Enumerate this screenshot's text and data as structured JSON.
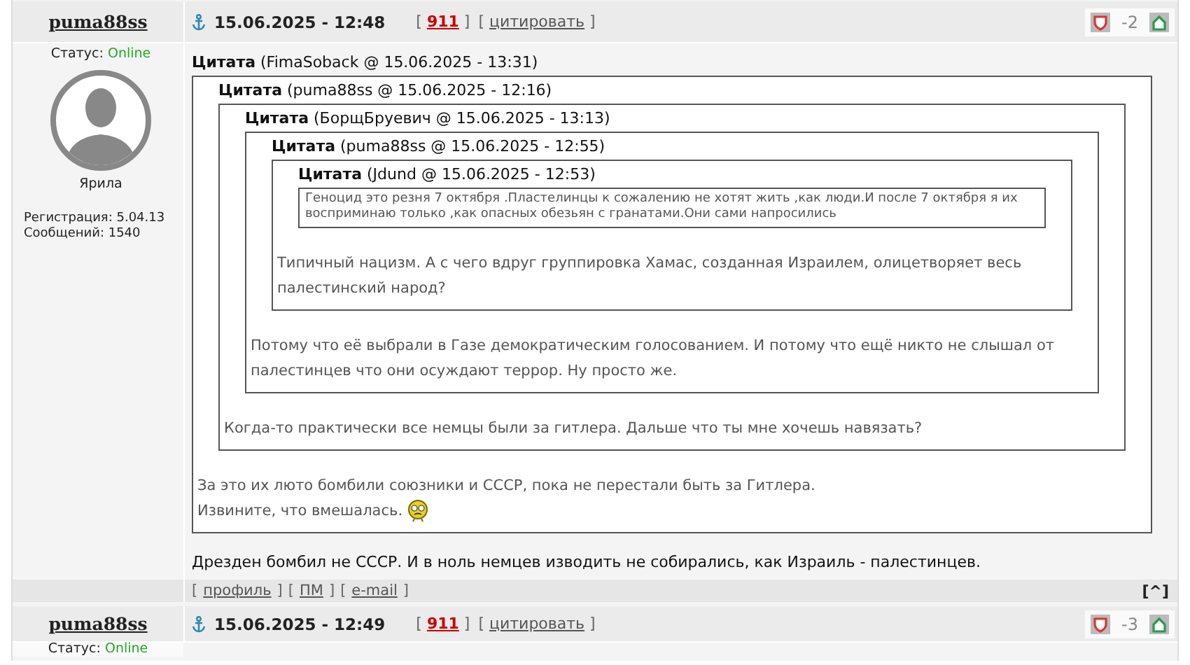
{
  "posts": [
    {
      "author": "puma88ss",
      "date": "15.06.2025 - 12:48",
      "links": [
        {
          "open": "[",
          "text": "911",
          "close": "]",
          "kind": "number"
        },
        {
          "open": "[",
          "text": "цитировать",
          "close": "]",
          "kind": "link"
        }
      ],
      "rating": "-2",
      "status_label": "Статус:",
      "status": "Online",
      "rank": "Ярила",
      "stats": [
        "Регистрация: 5.04.13",
        "Сообщений: 1540"
      ],
      "quote": {
        "header": "**Цитата** (FimaSoback @ 15.06.2025 - 13:31)",
        "quote": {
          "header": "**Цитата** (puma88ss @ 15.06.2025 - 12:16)",
          "quote": {
            "header": "**Цитата** (БорщБруевич @ 15.06.2025 - 13:13)",
            "quote": {
              "header": "**Цитата** (puma88ss @ 15.06.2025 - 12:55)",
              "quote": {
                "header": "**Цитата** (Jdund @ 15.06.2025 - 12:53)",
                "lines": [
                  "Геноцид это резня 7 октября .Пластелинцы к сожалению не хотят жить ,как люди.И после 7 октября я их восприминаю только ,как опасных обезьян с гранатами.Они сами напросились"
                ]
              },
              "lines": [
                "Типичный нацизм. А с чего вдруг группировка Хамас, созданная Израилем, олицетворяет весь палестинский народ?"
              ]
            },
            "lines": [
              "Потому что её выбрали в Газе демократическим голосованием. И потому что ещё никто не слышал от палестинцев что они осуждают террор. Ну просто же."
            ]
          },
          "lines": [
            "Когда-то практически все немцы были за гитлера. Дальше что ты мне хочешь навязать?"
          ]
        },
        "lines": [
          "За это их люто бомбили союзники и СССР, пока не перестали быть за Гитлера.",
          "Извините, что вмешалась."
        ],
        "smiley": true
      },
      "text": "Дрезден бомбил не СССР. И в ноль немцев изводить не собирались, как Израиль - палестинцев.",
      "footer_links": [
        {
          "open": "[",
          "text": "профиль",
          "close": "]"
        },
        {
          "open": "[",
          "text": "ПМ",
          "close": "]"
        },
        {
          "open": "[",
          "text": "e-mail",
          "close": "]"
        }
      ],
      "top_link": "[^]"
    },
    {
      "author": "puma88ss",
      "date": "15.06.2025 - 12:49",
      "links": [
        {
          "open": "[",
          "text": "911",
          "close": "]",
          "kind": "number"
        },
        {
          "open": "[",
          "text": "цитировать",
          "close": "]",
          "kind": "link"
        }
      ],
      "rating": "-3",
      "status_label": "Статус:",
      "status": "Online"
    }
  ]
}
